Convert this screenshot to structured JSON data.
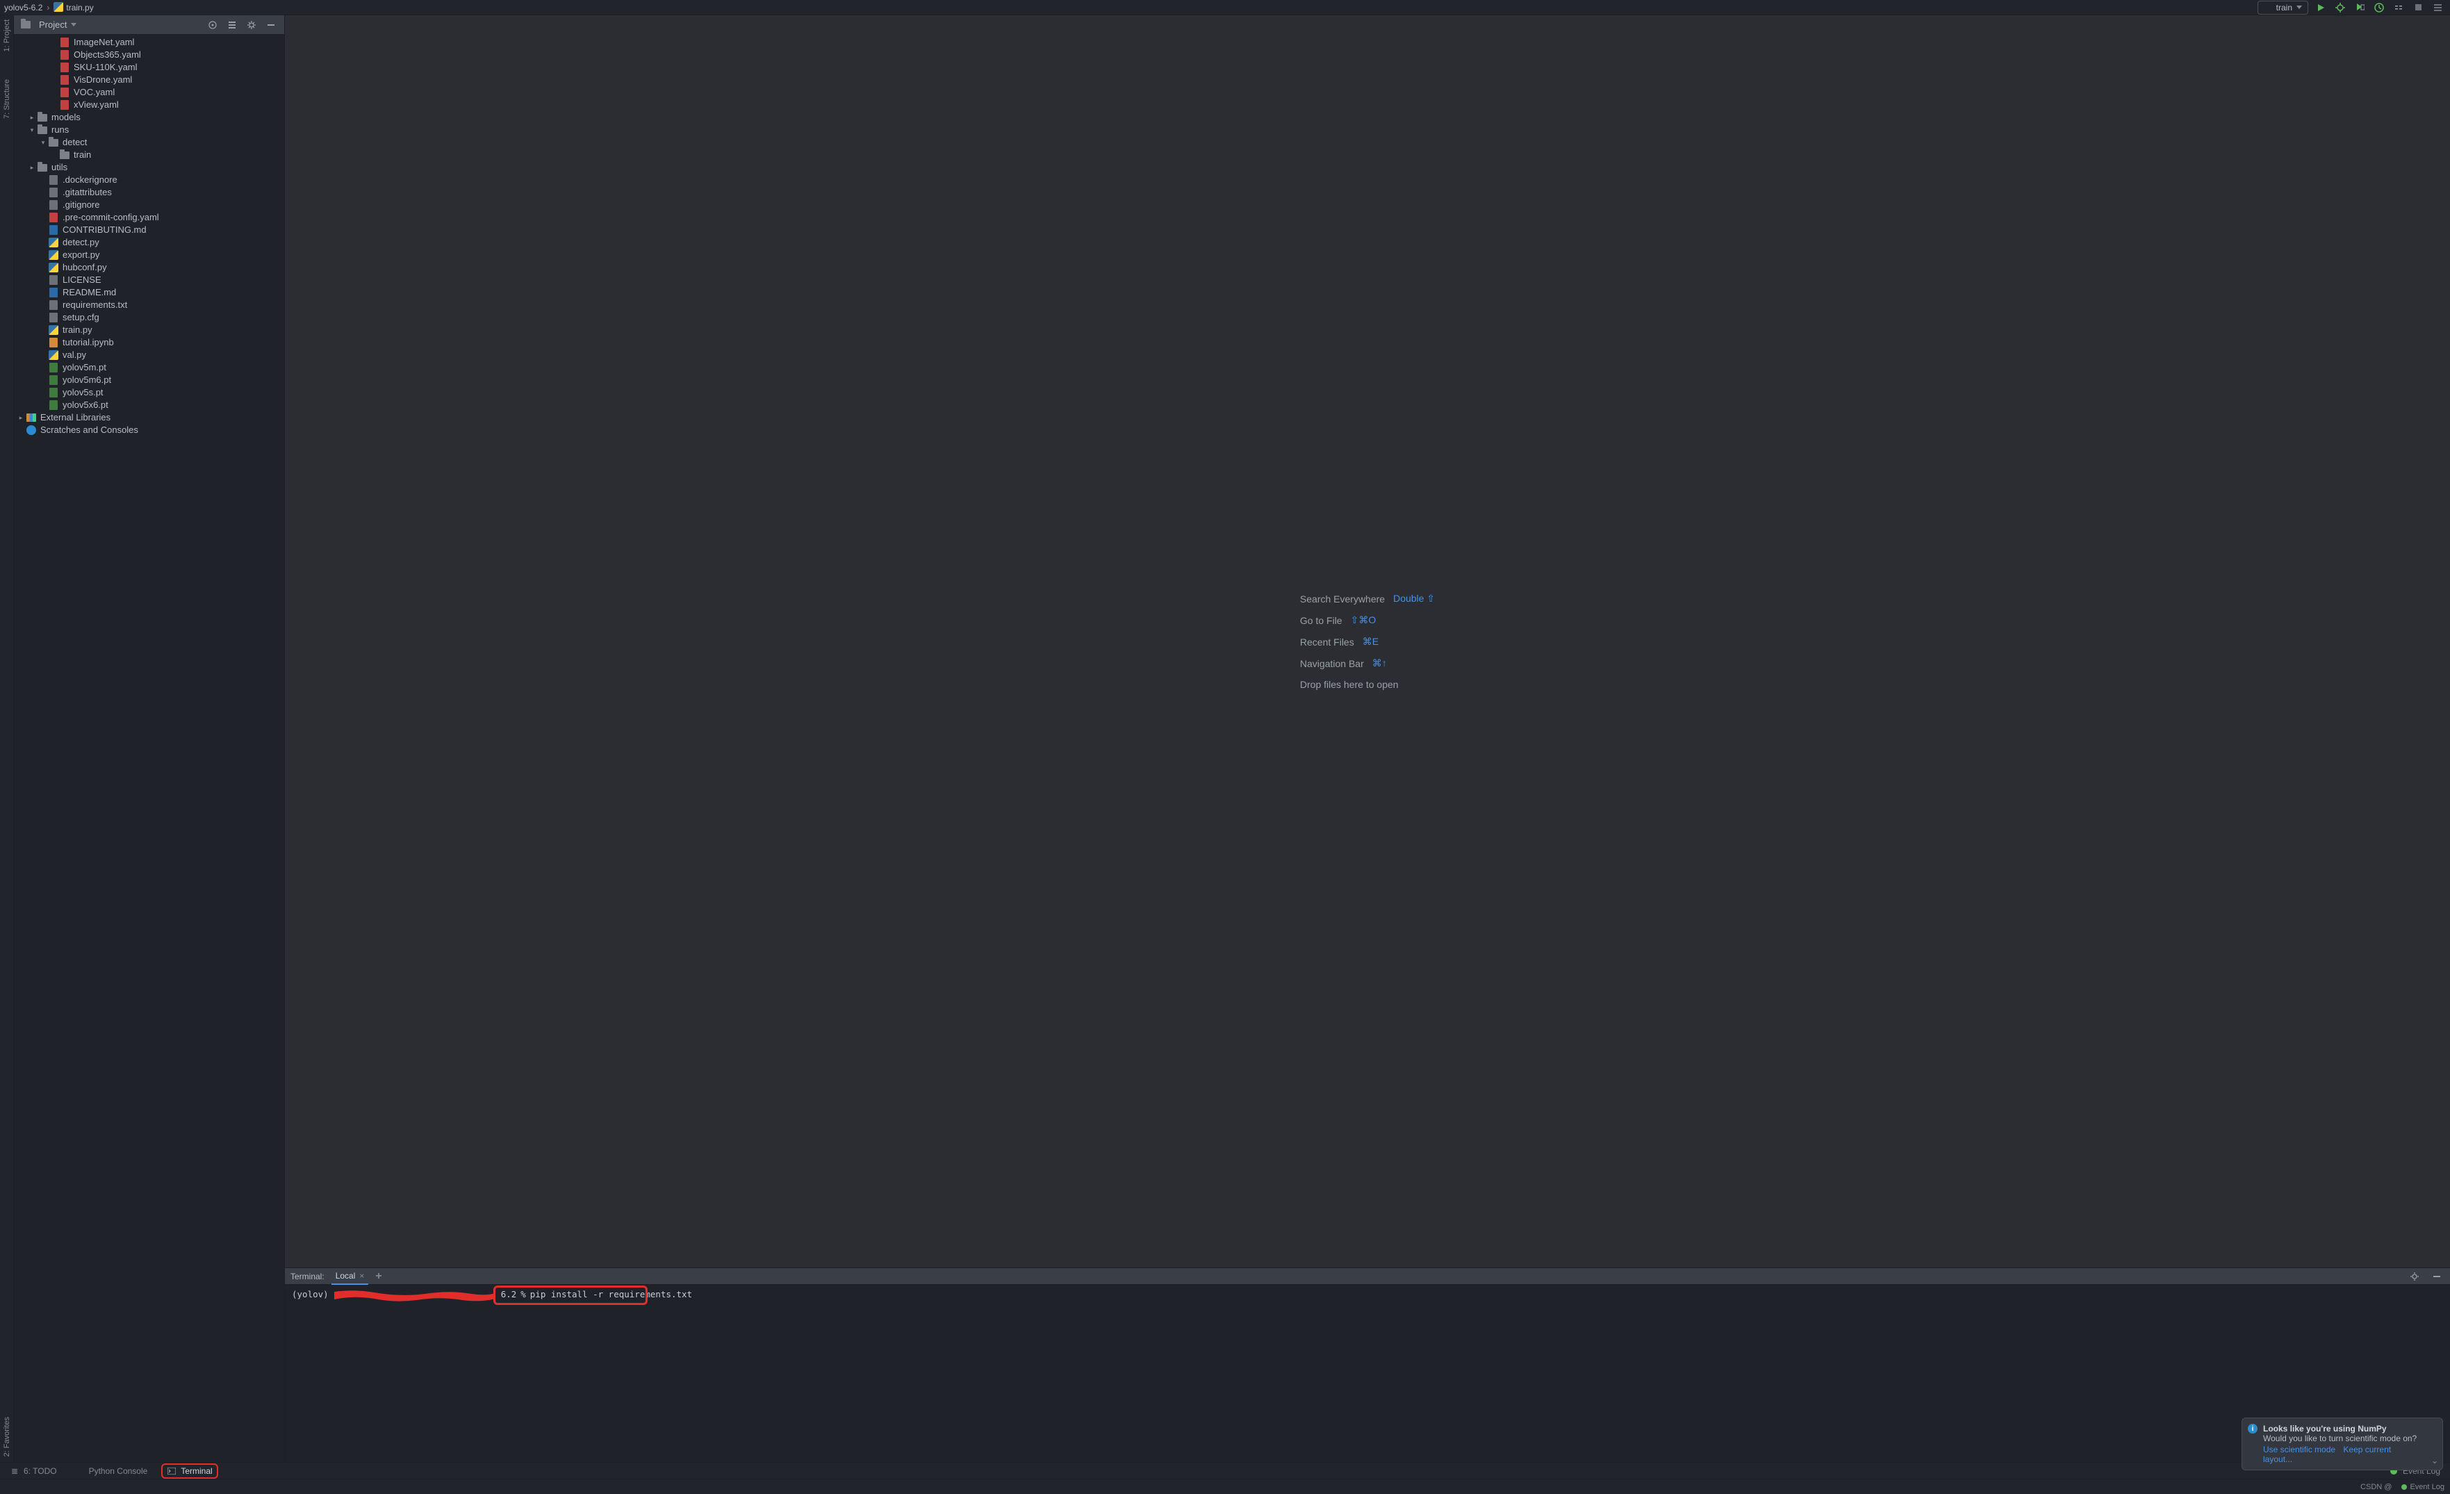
{
  "breadcrumb": {
    "root": "yolov5-6.2",
    "file": "train.py"
  },
  "run": {
    "config_name": "train"
  },
  "project_panel": {
    "title": "Project"
  },
  "tree": {
    "yaml_files": [
      "ImageNet.yaml",
      "Objects365.yaml",
      "SKU-110K.yaml",
      "VisDrone.yaml",
      "VOC.yaml",
      "xView.yaml"
    ],
    "models": "models",
    "runs": {
      "label": "runs",
      "detect": "detect",
      "train": "train"
    },
    "utils": "utils",
    "files": [
      {
        "name": ".dockerignore",
        "type": "generic"
      },
      {
        "name": ".gitattributes",
        "type": "generic"
      },
      {
        "name": ".gitignore",
        "type": "generic"
      },
      {
        "name": ".pre-commit-config.yaml",
        "type": "yaml"
      },
      {
        "name": "CONTRIBUTING.md",
        "type": "md"
      },
      {
        "name": "detect.py",
        "type": "py"
      },
      {
        "name": "export.py",
        "type": "py"
      },
      {
        "name": "hubconf.py",
        "type": "py"
      },
      {
        "name": "LICENSE",
        "type": "generic"
      },
      {
        "name": "README.md",
        "type": "md"
      },
      {
        "name": "requirements.txt",
        "type": "generic"
      },
      {
        "name": "setup.cfg",
        "type": "generic"
      },
      {
        "name": "train.py",
        "type": "py"
      },
      {
        "name": "tutorial.ipynb",
        "type": "ipynb"
      },
      {
        "name": "val.py",
        "type": "py"
      },
      {
        "name": "yolov5m.pt",
        "type": "pt"
      },
      {
        "name": "yolov5m6.pt",
        "type": "pt"
      },
      {
        "name": "yolov5s.pt",
        "type": "pt"
      },
      {
        "name": "yolov5x6.pt",
        "type": "pt"
      }
    ],
    "external": "External Libraries",
    "scratches": "Scratches and Consoles"
  },
  "hints": {
    "search": {
      "label": "Search Everywhere",
      "shortcut": "Double ⇧"
    },
    "goto": {
      "label": "Go to File",
      "shortcut": "⇧⌘O"
    },
    "recent": {
      "label": "Recent Files",
      "shortcut": "⌘E"
    },
    "nav": {
      "label": "Navigation Bar",
      "shortcut": "⌘↑"
    },
    "drop": {
      "label": "Drop files here to open"
    }
  },
  "terminal": {
    "title": "Terminal:",
    "tab": "Local",
    "env": "(yolov)",
    "dir_fragment": "6.2",
    "prompt_char": "%",
    "command": "pip install -r requirements.txt"
  },
  "bottom": {
    "todo": "6: TODO",
    "pyconsole": "Python Console",
    "terminal": "Terminal",
    "eventlog": "Event Log"
  },
  "notif": {
    "title": "Looks like you're using NumPy",
    "body": "Would you like to turn scientific mode on?",
    "link1": "Use scientific mode",
    "link2": "Keep current layout..."
  },
  "status": {
    "csdn": "CSDN @",
    "eventlog": "Event Log"
  },
  "rails": {
    "project": "1: Project",
    "structure": "7: Structure",
    "favorites": "2: Favorites"
  }
}
